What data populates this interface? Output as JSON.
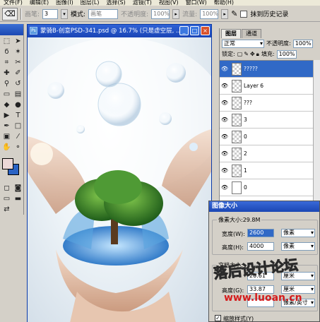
{
  "menu": [
    "文件(F)",
    "编辑(E)",
    "图像(I)",
    "图层(L)",
    "选择(S)",
    "滤镜(T)",
    "视图(V)",
    "窗口(W)",
    "帮助(H)"
  ],
  "options": {
    "brush_label": "画笔:",
    "brush_size": "3",
    "mode_label": "模式:",
    "mode_value": "画笔",
    "opacity_label": "不透明度:",
    "opacity_value": "100%",
    "flow_label": "流量:",
    "flow_value": "100%",
    "erase_history_label": "抹到历史记录"
  },
  "document": {
    "title": "蒙骑B-创意PSD-341.psd @ 16.7% (只是虚空层, ..."
  },
  "layers_panel": {
    "tabs": [
      "图层",
      "通道"
    ],
    "blend_mode": "正常",
    "opacity_label": "不透明度:",
    "opacity_value": "100%",
    "lock_label": "锁定:",
    "fill_label": "填充:",
    "fill_value": "100%",
    "layers": [
      {
        "name": "?????",
        "selected": true
      },
      {
        "name": "Layer 6",
        "selected": false
      },
      {
        "name": "???",
        "selected": false
      },
      {
        "name": "3",
        "selected": false
      },
      {
        "name": "0",
        "selected": false
      },
      {
        "name": "2",
        "selected": false
      },
      {
        "name": "1",
        "selected": false
      },
      {
        "name": "0",
        "selected": false
      }
    ]
  },
  "image_size_dialog": {
    "title": "图像大小",
    "pixel_dims_label": "像素大小:29.8M",
    "width_label": "宽度(W):",
    "width_value": "2600",
    "width_unit": "像素",
    "height_label": "高度(H):",
    "height_value": "4000",
    "height_unit": "像素",
    "doc_size_label": "文档大小:",
    "doc_width_value": "20.61",
    "doc_width_unit": "厘米",
    "doc_height_label": "高度(G):",
    "doc_height_value": "33.87",
    "doc_height_unit": "厘米",
    "resolution_unit": "像素/英寸",
    "scale_styles_label": "缩放样式(Y)"
  },
  "watermark": {
    "text": "落后设计论坛",
    "url": "www.luoan.cn"
  }
}
